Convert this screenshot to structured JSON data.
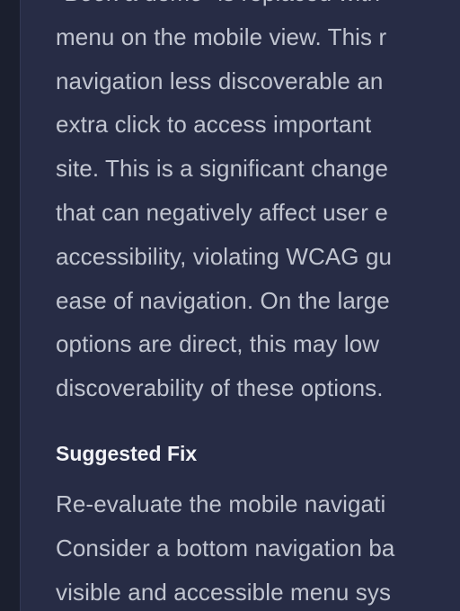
{
  "colors": {
    "panel_background": "#272c45",
    "page_background": "#1e2233",
    "body_text": "#c1c5d0",
    "heading_text": "#f2f3f7"
  },
  "issue": {
    "description_lines": [
      "\"Book a demo\" is replaced with",
      "menu on the mobile view. This r",
      "navigation less discoverable an",
      "extra click to access important",
      "site. This is a significant change",
      "that can negatively affect user e",
      "accessibility, violating WCAG gu",
      "ease of navigation. On the large",
      "options are direct, this may low",
      "discoverability of these options."
    ]
  },
  "suggested_fix": {
    "heading": "Suggested Fix",
    "lines": [
      "Re-evaluate the mobile navigati",
      "Consider a bottom navigation ba",
      "visible and accessible menu sys"
    ]
  }
}
